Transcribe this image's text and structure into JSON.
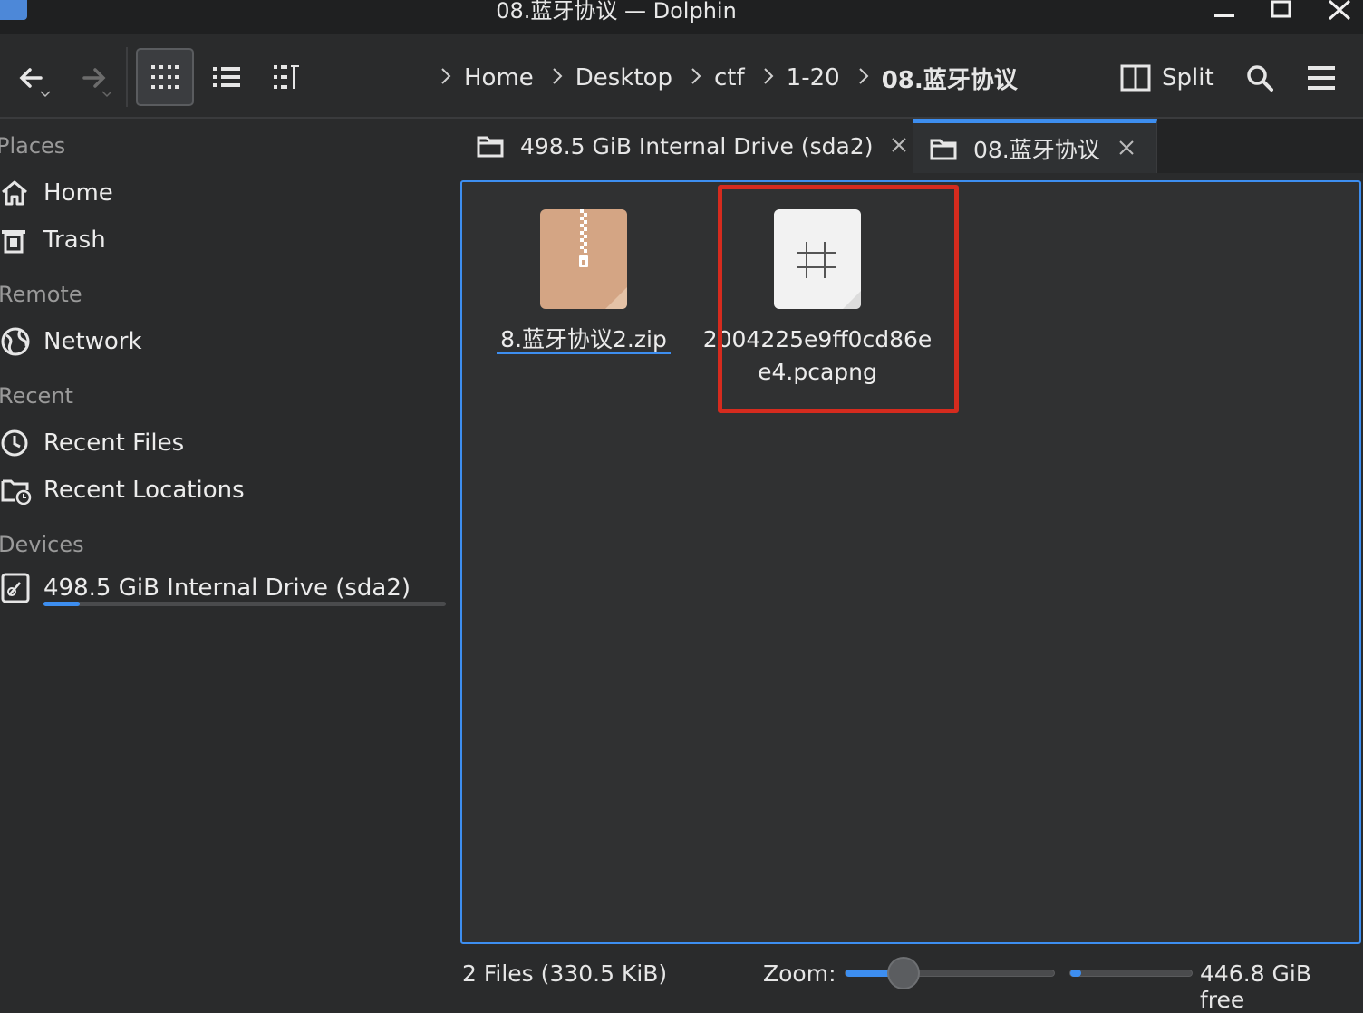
{
  "window": {
    "title": "08.蓝牙协议 — Dolphin",
    "minimize": "—",
    "maximize": "☐",
    "close": "✕"
  },
  "toolbar": {
    "back_icon": "arrow-left",
    "forward_icon": "arrow-right",
    "views": [
      "icons",
      "details",
      "compact"
    ],
    "active_view": "icons",
    "split_label": "Split"
  },
  "breadcrumb": [
    "Home",
    "Desktop",
    "ctf",
    "1-20",
    "08.蓝牙协议"
  ],
  "sidebar": {
    "places_title": "Places",
    "places": [
      {
        "label": "Home",
        "icon": "home-icon"
      },
      {
        "label": "Trash",
        "icon": "trash-icon"
      }
    ],
    "remote_title": "Remote",
    "remote": [
      {
        "label": "Network",
        "icon": "network-icon"
      }
    ],
    "recent_title": "Recent",
    "recent": [
      {
        "label": "Recent Files",
        "icon": "clock-icon"
      },
      {
        "label": "Recent Locations",
        "icon": "folder-clock-icon"
      }
    ],
    "devices_title": "Devices",
    "devices": [
      {
        "label": "498.5 GiB Internal Drive (sda2)",
        "icon": "drive-icon",
        "usage_fraction": 0.09
      }
    ]
  },
  "tabs": [
    {
      "label": "498.5 GiB Internal Drive (sda2)",
      "active": false
    },
    {
      "label": "08.蓝牙协议",
      "active": true
    }
  ],
  "files": [
    {
      "name": "8.蓝牙协议2.zip",
      "type": "zip-archive",
      "selected": true
    },
    {
      "name_line1": "2004225e9ff0cd86e",
      "name_line2": "e4.pcapng",
      "type": "pcapng-capture",
      "highlighted": true
    }
  ],
  "status": {
    "summary": "2 Files (330.5 KiB)",
    "zoom_label": "Zoom:",
    "zoom_fraction": 0.28,
    "free_space": "446.8 GiB free",
    "used_fraction": 0.09
  },
  "colors": {
    "accent": "#3d8ef0",
    "highlight": "#d52b1e",
    "zip_icon": "#d4a584",
    "background": "#2a2b2c"
  }
}
